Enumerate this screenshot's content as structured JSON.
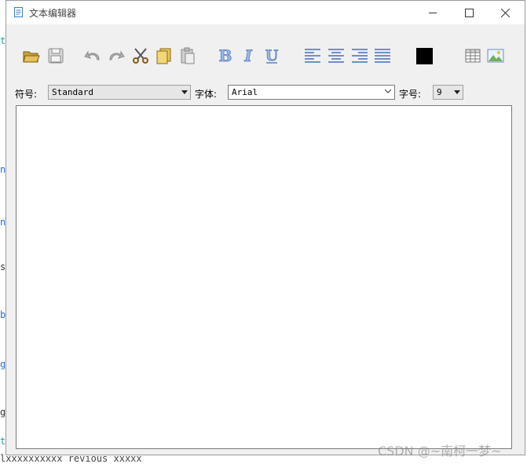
{
  "window": {
    "title": "文本编辑器"
  },
  "toolbar": {
    "buttons": [
      "open-icon",
      "save-icon",
      "undo-icon",
      "redo-icon",
      "cut-icon",
      "copy-icon",
      "paste-icon",
      "bold-icon",
      "italic-icon",
      "underline-icon",
      "align-left-icon",
      "align-center-icon",
      "align-right-icon",
      "align-justify-icon",
      "color-swatch",
      "table-icon",
      "image-icon"
    ],
    "bold_label": "B",
    "italic_label": "I",
    "underline_label": "U",
    "text_color": "#000000"
  },
  "format": {
    "style_label": "符号:",
    "style_value": "Standard",
    "font_label": "字体:",
    "font_value": "Arial",
    "size_label": "字号:",
    "size_value": "9"
  },
  "editor": {
    "content": ""
  },
  "watermark": "CSDN @~南柯一梦~",
  "background": {
    "marks": [
      "t",
      "n",
      "n",
      "s",
      "b",
      "g",
      "g",
      "t"
    ],
    "bottom_line": "lxxxxxxxxxx  revious  xxxxx"
  }
}
